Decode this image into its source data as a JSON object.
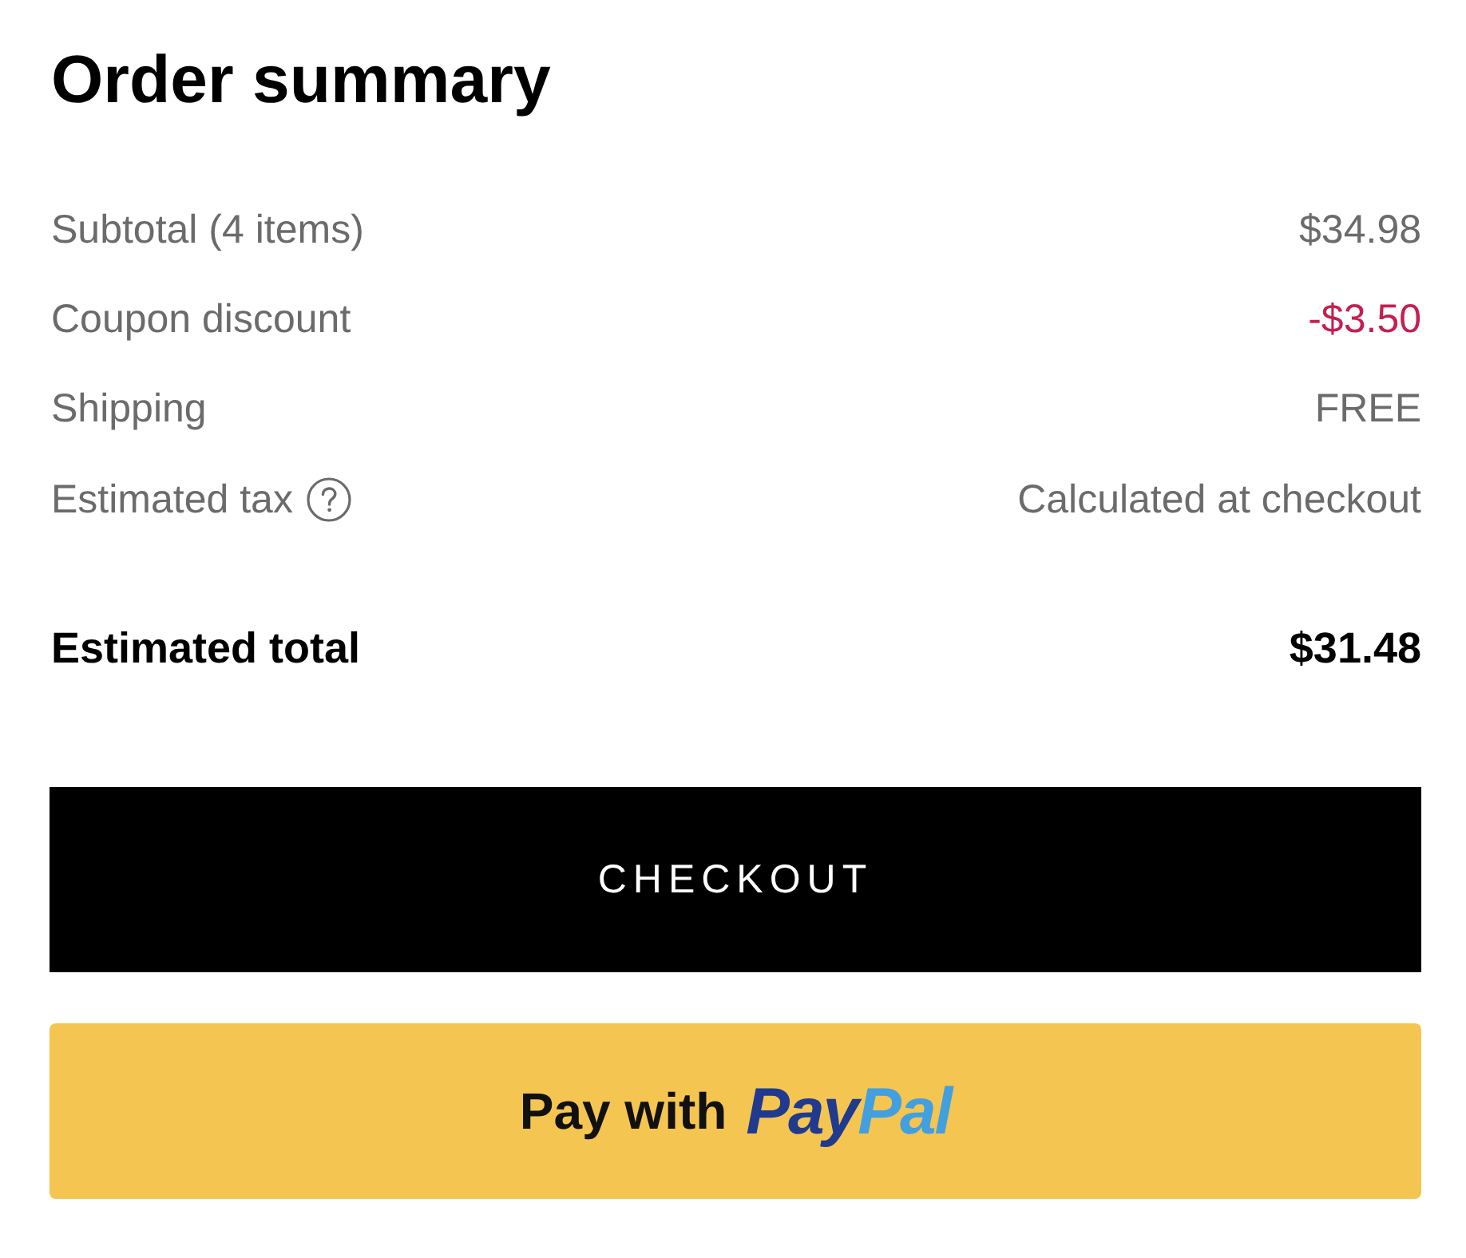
{
  "title": "Order summary",
  "lines": [
    {
      "label": "Subtotal (4 items)",
      "value": "$34.98",
      "kind": "plain"
    },
    {
      "label": "Coupon discount",
      "value": "-$3.50",
      "kind": "discount"
    },
    {
      "label": "Shipping",
      "value": "FREE",
      "kind": "plain"
    },
    {
      "label": "Estimated tax",
      "value": "Calculated at checkout",
      "kind": "help"
    }
  ],
  "total": {
    "label": "Estimated total",
    "value": "$31.48"
  },
  "checkout_button": {
    "label": "CHECKOUT"
  },
  "paypal_button": {
    "label": "Pay with",
    "logo": [
      {
        "text": "Pay",
        "color": "#1f3a8f"
      },
      {
        "text": "Pal",
        "color": "#429fe0"
      }
    ]
  }
}
